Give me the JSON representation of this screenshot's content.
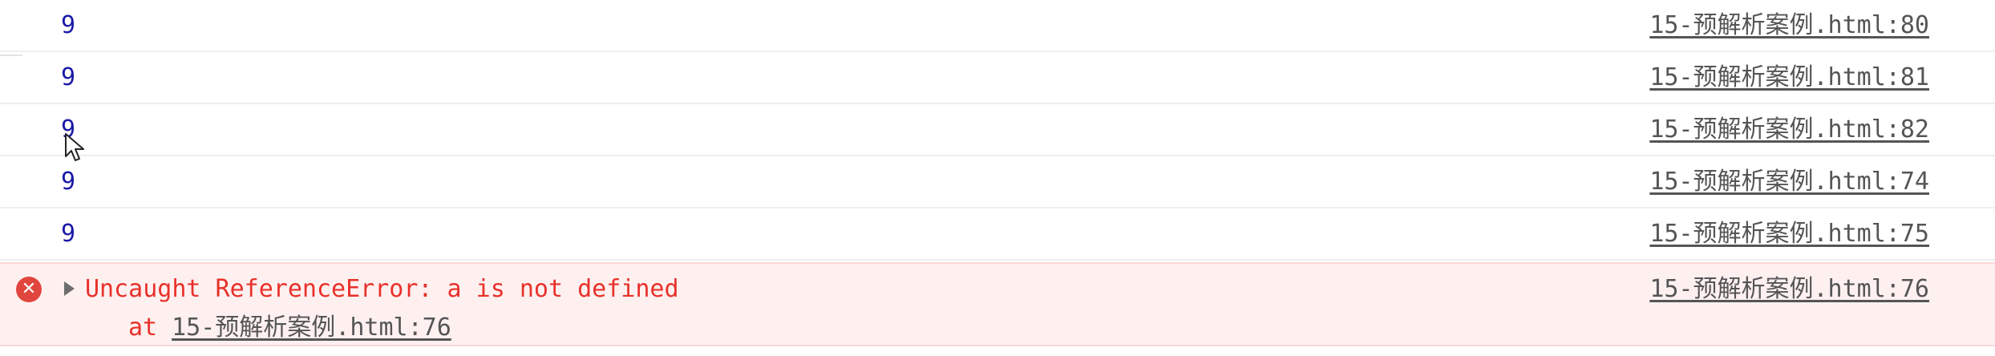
{
  "rows": [
    {
      "value": "9",
      "source": "15-预解析案例.html:80"
    },
    {
      "value": "9",
      "source": "15-预解析案例.html:81"
    },
    {
      "value": "9",
      "source": "15-预解析案例.html:82"
    },
    {
      "value": "9",
      "source": "15-预解析案例.html:74"
    },
    {
      "value": "9",
      "source": "15-预解析案例.html:75"
    }
  ],
  "error": {
    "icon": "error-circle-icon",
    "icon_glyph": "✕",
    "message": "Uncaught ReferenceError: a is not defined",
    "stack_prefix": "at",
    "stack_link": "15-预解析案例.html:76",
    "source": "15-预解析案例.html:76"
  },
  "colors": {
    "log_value": "#1a1aa6",
    "error_text": "#e8312a",
    "error_bg": "#fff0f0",
    "link": "#555555"
  }
}
